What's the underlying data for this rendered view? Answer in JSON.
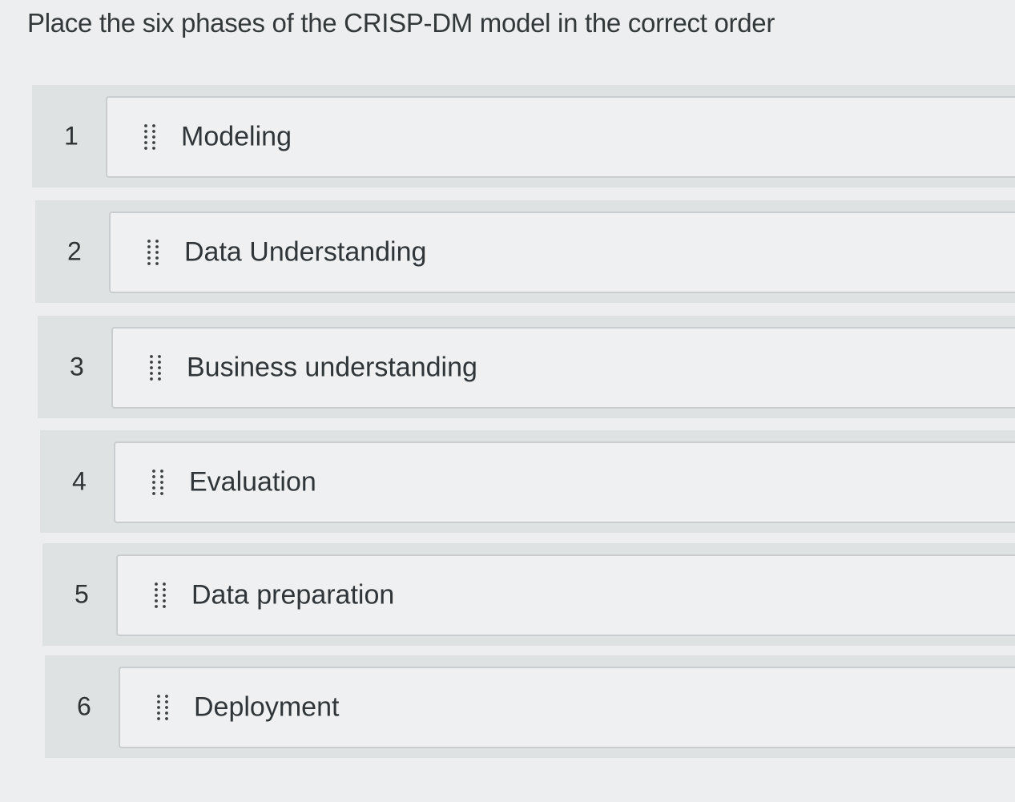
{
  "question": {
    "text": "Place the six phases of the CRISP-DM model in the correct  order"
  },
  "items": [
    {
      "number": "1",
      "label": "Modeling",
      "icon": "drag-handle-icon"
    },
    {
      "number": "2",
      "label": "Data Understanding",
      "icon": "drag-handle-icon"
    },
    {
      "number": "3",
      "label": "Business understanding",
      "icon": "drag-handle-icon"
    },
    {
      "number": "4",
      "label": "Evaluation",
      "icon": "drag-handle-icon"
    },
    {
      "number": "5",
      "label": "Data preparation",
      "icon": "drag-handle-icon"
    },
    {
      "number": "6",
      "label": "Deployment",
      "icon": "drag-handle-icon"
    }
  ]
}
